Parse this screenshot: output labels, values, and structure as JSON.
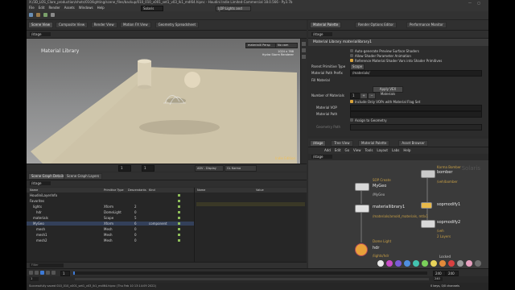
{
  "window": {
    "title": "X:/3D_LOS_Clare_production/shots/010/lighting/scene_files/backup/010_010_v001_set1_v03_lk1_mdl64.hipnc - Houdini Indie Limited-Commercial 18.0.566 - Py3.7b"
  },
  "menubar": {
    "items": [
      "File",
      "Edit",
      "Render",
      "Assets",
      "Windows",
      "Help"
    ],
    "desktop_label": "Solaris",
    "workspace_label": "LOP Lights and Cameras"
  },
  "left_tabs": [
    "Scene View",
    "Composite View",
    "Render View",
    "Motion FX View",
    "Geometry Spreadsheet"
  ],
  "viewport": {
    "path": "/stage",
    "title": "Material Library",
    "camera_btn": "materialX Persp",
    "render_btn": "No cam",
    "stats": [
      "1024 x 768",
      "Hydra Storm Renderer"
    ],
    "watermark": "Indie Edition",
    "frame_field": "1",
    "frame_field2": "1"
  },
  "playback": {
    "render_label": "GL Karma",
    "display_label": "ADV - Display"
  },
  "scene_graph": {
    "tabs": [
      "Scene Graph Details",
      "Scene Graph Layers"
    ],
    "path": "/stage",
    "columns": [
      "Name",
      "Primitive Type",
      "Descendants",
      "Kind"
    ],
    "detail_columns": [
      "Name",
      "Value"
    ],
    "rows": [
      {
        "name": "HoudiniLayerInfo",
        "type": "",
        "count": "",
        "kind": ""
      },
      {
        "name": "Favorites",
        "type": "",
        "count": "",
        "kind": ""
      },
      {
        "name": "lights",
        "type": "Xform",
        "count": "2",
        "kind": ""
      },
      {
        "name": "hdr",
        "type": "DomeLight",
        "count": "0",
        "kind": ""
      },
      {
        "name": "materials",
        "type": "Scope",
        "count": "5",
        "kind": ""
      },
      {
        "name": "MyGeo",
        "type": "Xform",
        "count": "6",
        "kind": "component"
      },
      {
        "name": "mesh",
        "type": "Mesh",
        "count": "0",
        "kind": ""
      },
      {
        "name": "mesh1",
        "type": "Mesh",
        "count": "0",
        "kind": ""
      },
      {
        "name": "mesh2",
        "type": "Mesh",
        "count": "0",
        "kind": ""
      }
    ],
    "filter_label": "Filter"
  },
  "timeline": {
    "start": "1",
    "end": "240",
    "current": "1",
    "end2": "240"
  },
  "status": {
    "text": "Successfully saved 010_010_v001_set1_v03_lk1_mdl64.hipnc (Thu Feb 10 13:14:09 2022)"
  },
  "params": {
    "tabs": [
      "Material Palette",
      "Render Options Editor",
      "Performance Monitor"
    ],
    "path": "/stage",
    "node_header": "Material Library   materiallibrary1",
    "checks": [
      "Auto-generate Preview Surface Shaders",
      "Allow Shader Parameter Animation",
      "Reference Material Shader Vars into Shader Primitives"
    ],
    "parent_prim_type_label": "Parent Primitive Type",
    "parent_prim_type_value": "Scope",
    "material_path_prefix_label": "Material Path Prefix",
    "material_path_prefix_value": "/materials/",
    "fill_section": "Fill Material",
    "apply_label": "Apply VEX Materials",
    "num_materials_label": "Number of Materials",
    "num_materials_value": "1",
    "include_label": "Include Only VOPs with Material Flag Set",
    "material_vop_label": "Material VOP",
    "material_path_label": "Material Path",
    "assign_label": "Assign to Geometry",
    "geometry_path_label": "Geometry Path"
  },
  "network": {
    "tabs": [
      "/stage",
      "Tree View",
      "Material Palette",
      "Asset Browser"
    ],
    "menu": [
      "Add",
      "Edit",
      "Go",
      "View",
      "Tools",
      "Layout",
      "Labs",
      "Help"
    ],
    "path": "/stage",
    "watermark": "Solaris",
    "nodes": [
      {
        "name": "MyGeo",
        "sub": "SOP Create",
        "path": "/MyGeo"
      },
      {
        "name": "materiallibrary1",
        "sub": "",
        "path": "/materials/arnold_materials, mtlx1"
      },
      {
        "name": "hdr",
        "sub": "Dome Light",
        "path": "/lights/hdr"
      },
      {
        "name": "bomber",
        "sub": "Karma Bomber",
        "path": "/veh/bomber"
      },
      {
        "name": "sopmodify1",
        "sub": "",
        "path": ""
      },
      {
        "name": "sopmodify2",
        "sub": "",
        "path": "/veh"
      }
    ],
    "layers_label": "2 Layers",
    "locked_label": "Locked",
    "palette_colors": [
      "#e8e8e8",
      "#c94cc7",
      "#7b5bd6",
      "#4f8fe0",
      "#43c4b0",
      "#7ad05a",
      "#e8d35a",
      "#e28a3a",
      "#d94040",
      "#9b9b9b",
      "#e8a0c0",
      "#6f6f6f"
    ]
  },
  "bottom_right": {
    "frame_label": "Auto Update",
    "keys_label": "0 keys, 0/0 channels",
    "anim_label": "Key All Channels"
  }
}
